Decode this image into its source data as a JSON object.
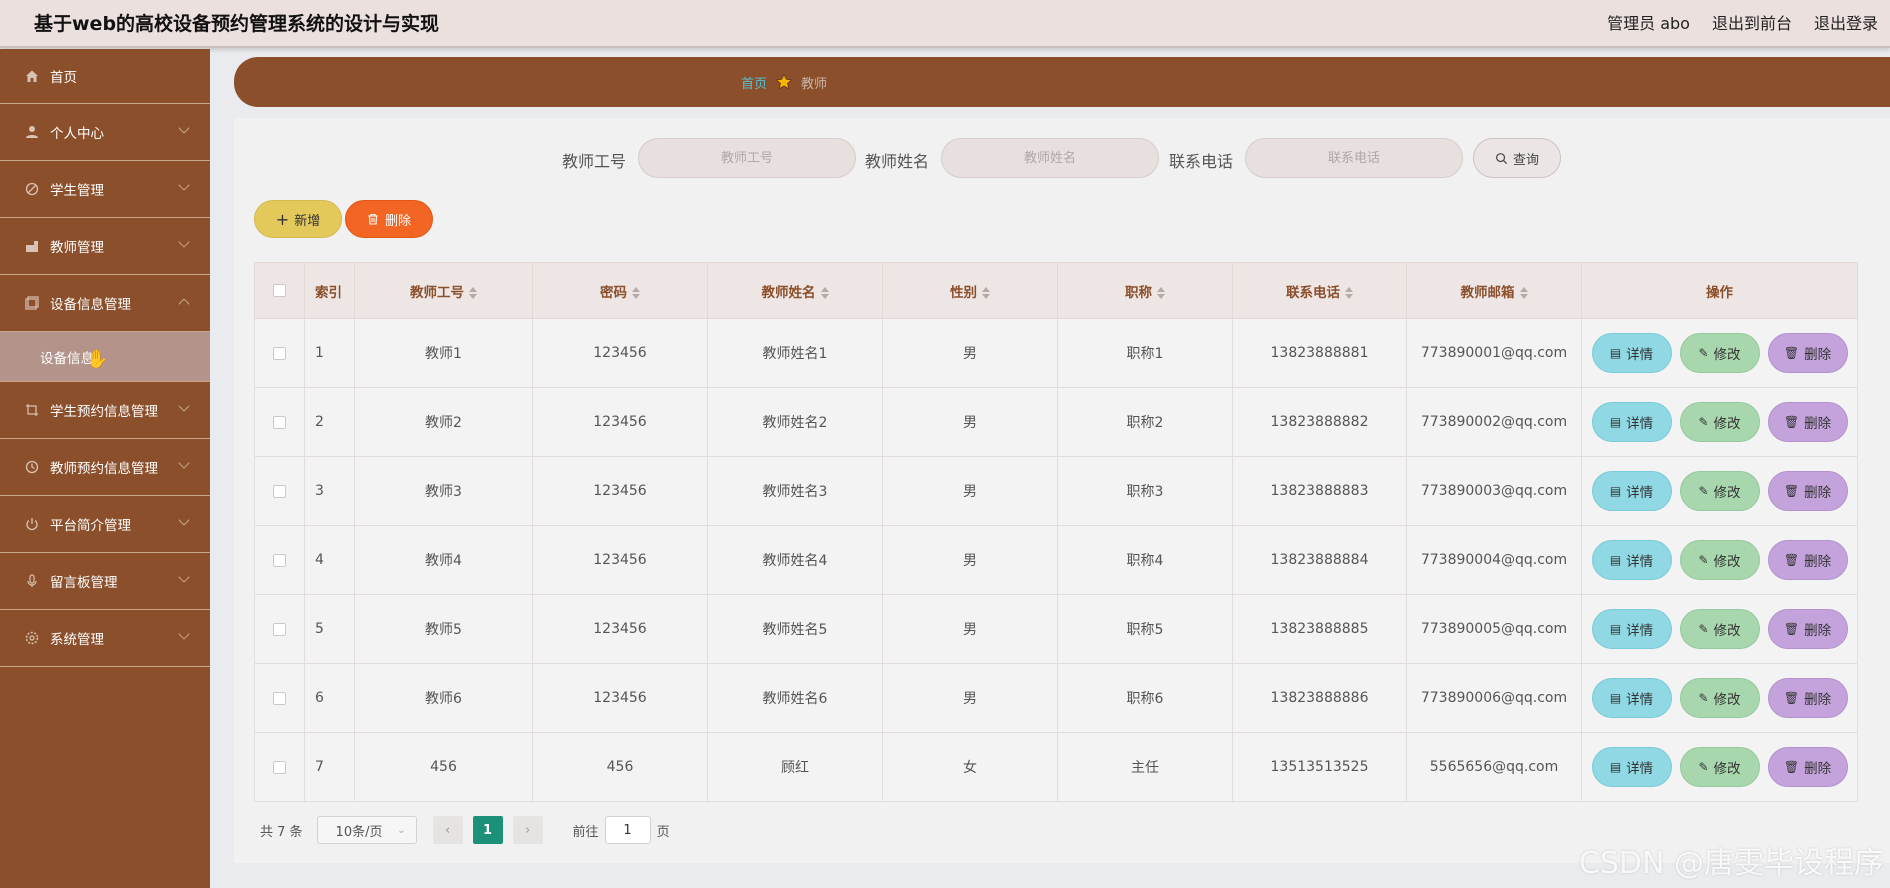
{
  "header": {
    "title": "基于web的高校设备预约管理系统的设计与实现",
    "admin_label": "管理员 abo",
    "to_front": "退出到前台",
    "logout": "退出登录"
  },
  "sidebar": {
    "items": [
      {
        "label": "首页",
        "icon": "home-icon"
      },
      {
        "label": "个人中心",
        "icon": "user-icon"
      },
      {
        "label": "学生管理",
        "icon": "student-icon"
      },
      {
        "label": "教师管理",
        "icon": "teacher-icon"
      },
      {
        "label": "设备信息管理",
        "icon": "device-icon"
      },
      {
        "label": "学生预约信息管理",
        "icon": "crop-icon"
      },
      {
        "label": "教师预约信息管理",
        "icon": "clock-icon"
      },
      {
        "label": "平台简介管理",
        "icon": "power-icon"
      },
      {
        "label": "留言板管理",
        "icon": "mic-icon"
      },
      {
        "label": "系统管理",
        "icon": "gear-icon"
      }
    ],
    "sub_item": "设备信息"
  },
  "breadcrumb": {
    "home": "首页",
    "current": "教师"
  },
  "search": {
    "id_label": "教师工号",
    "id_placeholder": "教师工号",
    "name_label": "教师姓名",
    "name_placeholder": "教师姓名",
    "phone_label": "联系电话",
    "phone_placeholder": "联系电话",
    "query_button": "查询"
  },
  "actions": {
    "add": "新增",
    "delete": "删除"
  },
  "table": {
    "headers": {
      "index": "索引",
      "id": "教师工号",
      "password": "密码",
      "name": "教师姓名",
      "gender": "性别",
      "title": "职称",
      "phone": "联系电话",
      "email": "教师邮箱",
      "ops": "操作"
    },
    "rows": [
      {
        "index": "1",
        "id": "教师1",
        "password": "123456",
        "name": "教师姓名1",
        "gender": "男",
        "title": "职称1",
        "phone": "13823888881",
        "email": "773890001@qq.com"
      },
      {
        "index": "2",
        "id": "教师2",
        "password": "123456",
        "name": "教师姓名2",
        "gender": "男",
        "title": "职称2",
        "phone": "13823888882",
        "email": "773890002@qq.com"
      },
      {
        "index": "3",
        "id": "教师3",
        "password": "123456",
        "name": "教师姓名3",
        "gender": "男",
        "title": "职称3",
        "phone": "13823888883",
        "email": "773890003@qq.com"
      },
      {
        "index": "4",
        "id": "教师4",
        "password": "123456",
        "name": "教师姓名4",
        "gender": "男",
        "title": "职称4",
        "phone": "13823888884",
        "email": "773890004@qq.com"
      },
      {
        "index": "5",
        "id": "教师5",
        "password": "123456",
        "name": "教师姓名5",
        "gender": "男",
        "title": "职称5",
        "phone": "13823888885",
        "email": "773890005@qq.com"
      },
      {
        "index": "6",
        "id": "教师6",
        "password": "123456",
        "name": "教师姓名6",
        "gender": "男",
        "title": "职称6",
        "phone": "13823888886",
        "email": "773890006@qq.com"
      },
      {
        "index": "7",
        "id": "456",
        "password": "456",
        "name": "顾红",
        "gender": "女",
        "title": "主任",
        "phone": "13513513525",
        "email": "5565656@qq.com"
      }
    ],
    "row_ops": {
      "detail": "详情",
      "edit": "修改",
      "remove": "删除"
    }
  },
  "pagination": {
    "total": "共 7 条",
    "page_size": "10条/页",
    "current_page": "1",
    "goto_prefix": "前往",
    "goto_value": "1",
    "goto_suffix": "页"
  },
  "watermark": "CSDN @唐雯毕设程序",
  "colors": {
    "sidebar": "#8b4f2b",
    "accent_link": "#4fc3d8",
    "add_button": "#e2c95a",
    "delete_button": "#f26522",
    "detail": "#8fd8e4",
    "edit": "#a8d7ae",
    "remove": "#c4a3dc",
    "page_active": "#1a9178"
  }
}
